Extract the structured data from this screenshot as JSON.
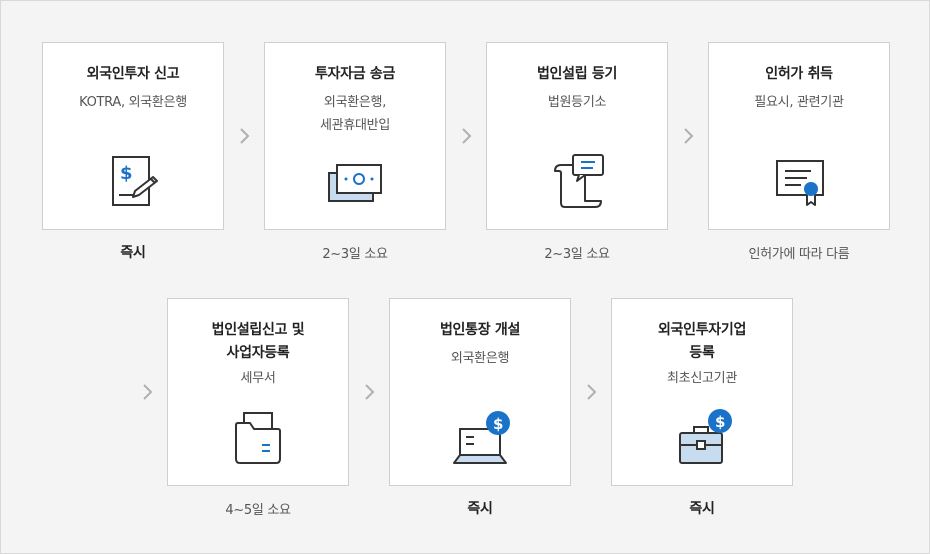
{
  "steps": [
    {
      "title": "외국인투자 신고",
      "sub": "KOTRA, 외국환은행",
      "duration": "즉시"
    },
    {
      "title": "투자자금 송금",
      "sub": "외국환은행,\n세관휴대반입",
      "duration": "2~3일 소요"
    },
    {
      "title": "법인설립 등기",
      "sub": "법원등기소",
      "duration": "2~3일 소요"
    },
    {
      "title": "인허가 취득",
      "sub": "필요시, 관련기관",
      "duration": "인허가에 따라 다름"
    },
    {
      "title": "법인설립신고 및\n사업자등록",
      "sub": "세무서",
      "duration": "4~5일 소요"
    },
    {
      "title": "법인통장 개설",
      "sub": "외국환은행",
      "duration": "즉시"
    },
    {
      "title": "외국인투자기업\n등록",
      "sub": "최초신고기관",
      "duration": "즉시"
    }
  ],
  "icons": [
    "document-dollar-pen-icon",
    "banknotes-icon",
    "scroll-chat-icon",
    "certificate-icon",
    "folders-icon",
    "laptop-dollar-icon",
    "briefcase-dollar-icon"
  ],
  "colors": {
    "accent": "#1a73c8",
    "light_blue": "#c8dcf0",
    "card_border": "#cfcfcf",
    "arrow": "#b0b0b0"
  }
}
